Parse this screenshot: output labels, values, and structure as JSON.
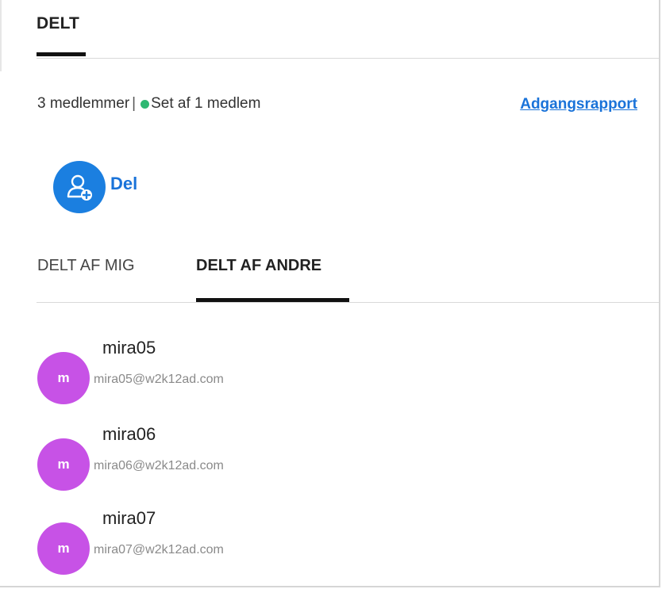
{
  "header": {
    "tab_label": "DELT"
  },
  "summary": {
    "members_text": "3 medlemmer",
    "separator": "|",
    "seen_text": "Set af 1 medlem",
    "access_report_link": "Adgangsrapport"
  },
  "share": {
    "label": "Del",
    "icon": "add-user-icon"
  },
  "subtabs": [
    {
      "label": "DELT AF MIG",
      "active": false
    },
    {
      "label": "DELT AF ANDRE",
      "active": true
    }
  ],
  "members": [
    {
      "initial": "m",
      "name": "mira05",
      "email": "mira05@w2k12ad.com"
    },
    {
      "initial": "m",
      "name": "mira06",
      "email": "mira06@w2k12ad.com"
    },
    {
      "initial": "m",
      "name": "mira07",
      "email": "mira07@w2k12ad.com"
    }
  ],
  "colors": {
    "accent": "#1a73d9",
    "share_circle": "#1b7fe0",
    "status_dot": "#2eb872",
    "avatar": "#c752e6"
  }
}
